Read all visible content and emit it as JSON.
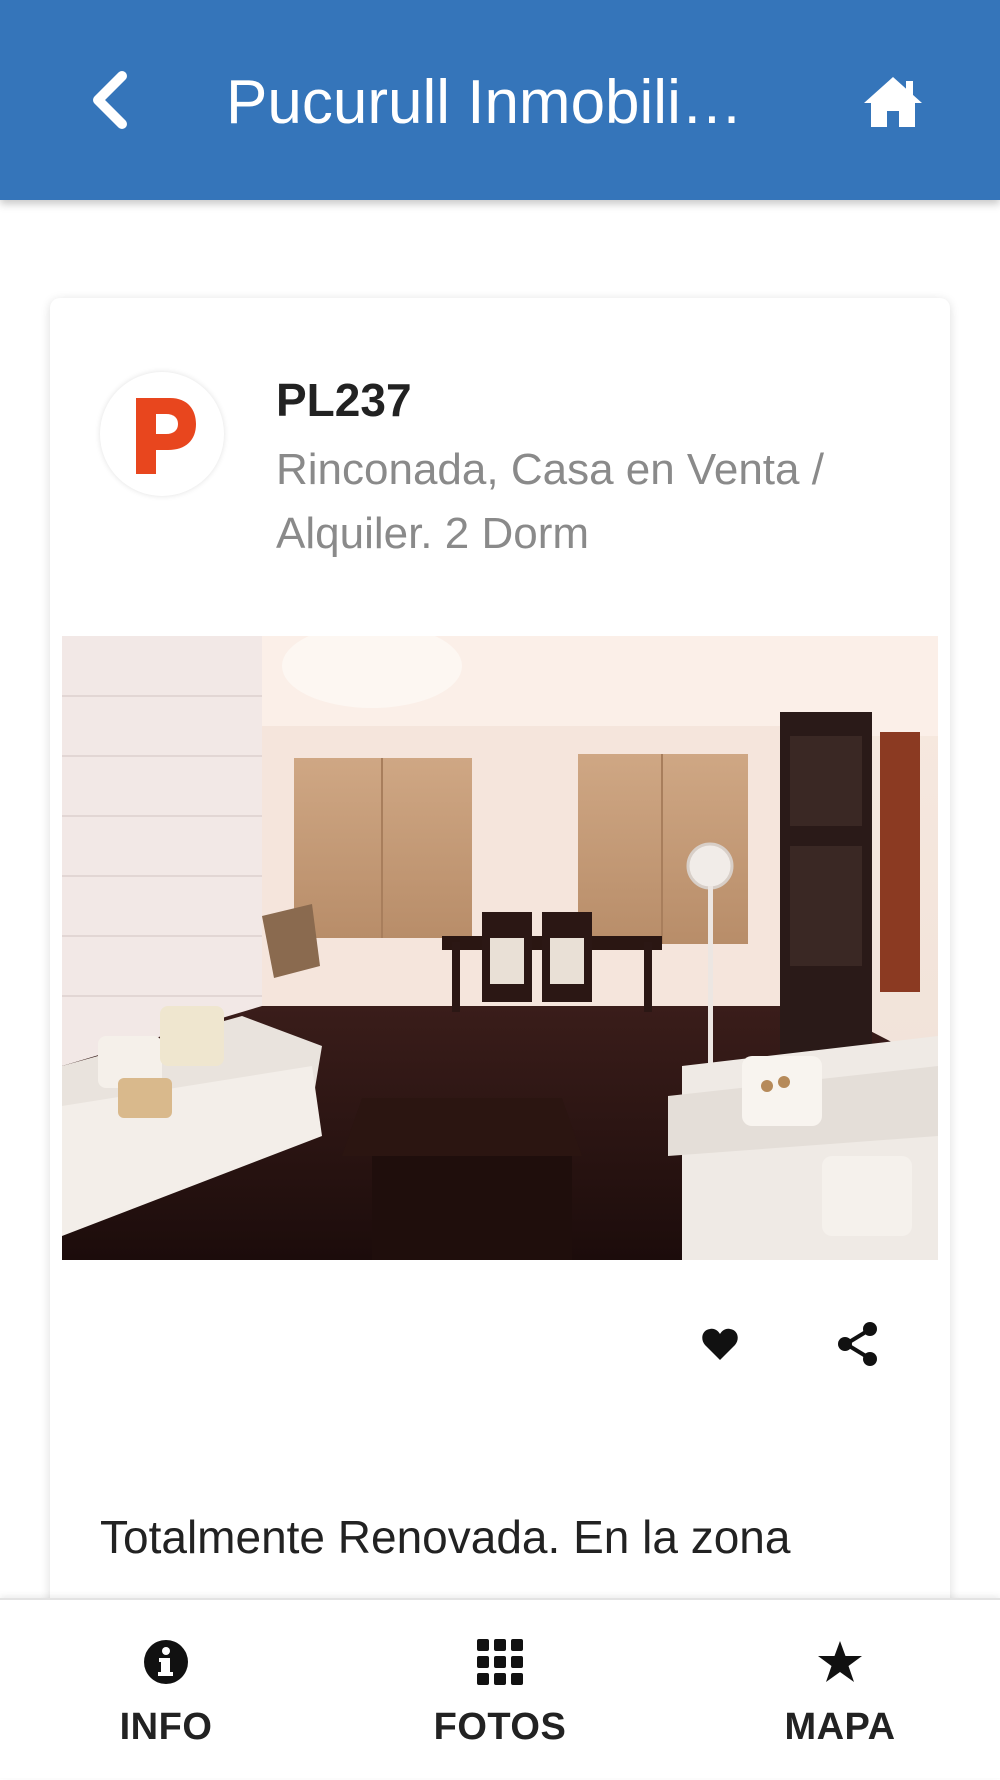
{
  "header": {
    "title": "Pucurull Inmobili…",
    "back_icon": "chevron-left-icon",
    "home_icon": "home-icon",
    "background_color": "#3575ba"
  },
  "listing": {
    "code": "PL237",
    "subtitle": "Rinconada, Casa en Venta / Alquiler. 2 Dorm",
    "logo_letter": "p",
    "logo_color": "#e8461e",
    "photo_subject": "living-room-photo",
    "actions": {
      "favorite_icon": "heart-icon",
      "share_icon": "share-icon"
    },
    "description": "Totalmente Renovada. En la zona"
  },
  "bottom_nav": {
    "items": [
      {
        "label": "INFO",
        "icon": "info-icon"
      },
      {
        "label": "FOTOS",
        "icon": "grid-icon"
      },
      {
        "label": "MAPA",
        "icon": "star-icon"
      }
    ]
  }
}
